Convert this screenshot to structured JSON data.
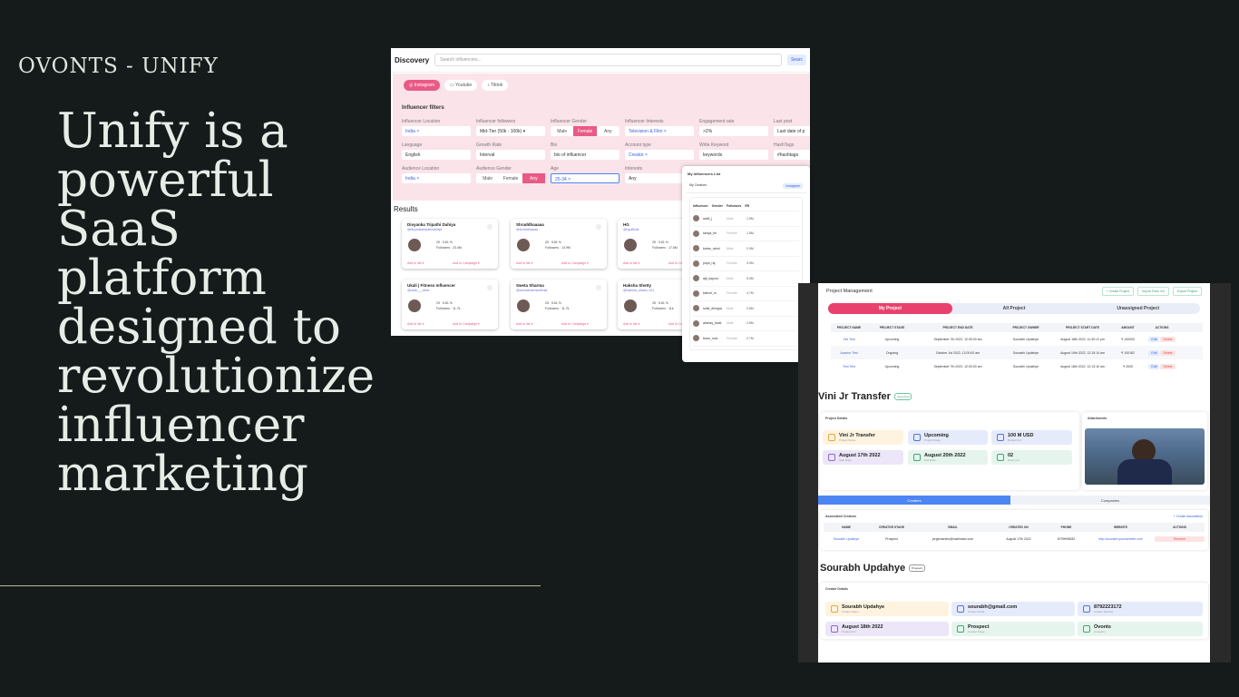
{
  "brand": "OVONTS - UNIFY",
  "headline": [
    "Unify is a",
    "powerful",
    "SaaS",
    "platform",
    "designed to",
    "revolutionize",
    "influencer",
    "marketing"
  ],
  "discovery": {
    "title": "Discovery",
    "search_placeholder": "Search influencers...",
    "search_button": "Searc",
    "tabs": [
      "Instagram",
      "Youtube",
      "Tiktok"
    ],
    "filters_title": "Influencer filters",
    "filters": [
      {
        "label": "Influencer Location",
        "value": "India ×"
      },
      {
        "label": "Influencer followers",
        "value": "Mid-Tier (50k - 100k) ▾"
      },
      {
        "label": "Influencer Gender",
        "segments": [
          "Male",
          "Female",
          "Any"
        ],
        "selected": "Female"
      },
      {
        "label": "Influencer Interests",
        "value": "Television & Film ×"
      },
      {
        "label": "Engagement rate",
        "value": ">2%"
      },
      {
        "label": "Last post",
        "value": "Last date of p"
      },
      {
        "label": "Language",
        "value": "English"
      },
      {
        "label": "Growth Rate",
        "value": "Interval"
      },
      {
        "label": "Bio",
        "value": "bio of influencer"
      },
      {
        "label": "Account type",
        "value": "Creator ×"
      },
      {
        "label": "Write Keyword",
        "value": "keywords"
      },
      {
        "label": "HashTags",
        "value": "#hashtags"
      },
      {
        "label": "Audience Location",
        "value": "India ×"
      },
      {
        "label": "Audience Gender",
        "segments": [
          "Male",
          "Female",
          "Any"
        ],
        "selected": "Any"
      },
      {
        "label": "Age",
        "value": "25-34 ×"
      },
      {
        "label": "Interests",
        "value": "Any"
      }
    ],
    "results_title": "Results",
    "cards": [
      {
        "name": "Divyanka Tripathi Dahiya",
        "handle": "@divyankatripathidahiya",
        "stats": [
          "29 · 5.81 %",
          "Followers · 23.4M"
        ],
        "b1": "Add to list ▾",
        "b2": "Add to Campaign ▾"
      },
      {
        "name": "Shraddhaaaaa",
        "handle": "@shraddhaaaa",
        "stats": [
          "25 · 5.81 %",
          "Followers · 13.9M"
        ],
        "b1": "Add to list ▾",
        "b2": "Add to Campaign ▾"
      },
      {
        "name": "HG",
        "handle": "@hgofficial",
        "stats": [
          "25 · 5.81 %",
          "Followers · 17.6M"
        ],
        "b1": "Add to list ▾",
        "b2": "Add to Campaign ▾"
      },
      {
        "name": "Ukali | Fitness Influencer",
        "handle": "@ukali___bebe",
        "stats": [
          "29 · 5.81 %",
          "Followers · 11.7k"
        ],
        "b1": "Add to list ▾",
        "b2": "Add to Campaign ▾"
      },
      {
        "name": "Sweta Sharma",
        "handle": "@swetasharmaofficial",
        "stats": [
          "25 · 5.81 %",
          "Followers · 11.7k"
        ],
        "b1": "Add to list ▾",
        "b2": "Add to Campaign ▾"
      },
      {
        "name": "Haksha Shetty",
        "handle": "@haksha_ahaan_001",
        "stats": [
          "25 · 5.81 %",
          "Followers · 11k"
        ],
        "b1": "Add to list ▾",
        "b2": "Add to Campaign ▾"
      }
    ]
  },
  "influencer_list": {
    "title": "My Influencers List",
    "subtitle": "My Creators",
    "tag": "Instagram",
    "headers": [
      "Influencer",
      "Gender",
      "Followers",
      "ER"
    ],
    "rows": [
      {
        "n": "ankit_j",
        "g": "Male",
        "c": "1.9M"
      },
      {
        "n": "taniya_bh",
        "g": "Female",
        "c": "1.8M"
      },
      {
        "n": "kahar_rahul",
        "g": "Male",
        "c": "2.0M"
      },
      {
        "n": "priya_raj",
        "g": "Female",
        "c": "3.0M"
      },
      {
        "n": "ajit_kapoor",
        "g": "Male",
        "c": "5.0M"
      },
      {
        "n": "kishori_m",
        "g": "Female",
        "c": "4.7M"
      },
      {
        "n": "sahil_dhingra",
        "g": "Male",
        "c": "2.6M"
      },
      {
        "n": "akshay_kwat",
        "g": "Male",
        "c": "2.8M"
      },
      {
        "n": "team_rock",
        "g": "Female",
        "c": "2.7M"
      }
    ]
  },
  "project": {
    "title": "Project Management",
    "actions": [
      "+ Create Project",
      "Import From Xcl",
      "Export Project"
    ],
    "tabs": [
      "My Project",
      "All Project",
      "Unassigned Project"
    ],
    "table_headers": [
      "PROJECT NAME",
      "PROJECT STAGE",
      "PROJECT END DATE",
      "PROJECT OWNER",
      "PROJECT START DATE",
      "AMOUNT",
      "ACTIONS"
    ],
    "rows": [
      {
        "name": "Vini Test",
        "stage": "Upcoming",
        "end": "September 7th 2022, 12:00:00 am",
        "owner": "Sourabh Updahye",
        "start": "August 18th 2022, 11:30:12 pm",
        "amount": "₹ 100000"
      },
      {
        "name": "Avantor Test",
        "stage": "Ongoing",
        "end": "October 1st 2022, 12:00:00 am",
        "owner": "Sourabh Updahye",
        "start": "August 19th 2022, 12:15:14 am",
        "amount": "₹ 100182"
      },
      {
        "name": "Test Test",
        "stage": "Upcoming",
        "end": "September 7th 2022, 12:00:00 am",
        "owner": "Sourabh Updahye",
        "start": "August 18th 2022, 12:13:10 am",
        "amount": "₹ 2000"
      }
    ],
    "edit_label": "Edit",
    "delete_label": "Delete",
    "detail_title": "Vini Jr Transfer",
    "detail_badge": "Upcoming",
    "details_panel": "Project Details",
    "attachments_panel": "Attachments",
    "tiles": [
      {
        "v": "Vini Jr Transfer",
        "s": "Project Name"
      },
      {
        "v": "Upcoming",
        "s": "Project Stage"
      },
      {
        "v": "100 M USD",
        "s": "Budget Amt"
      },
      {
        "v": "August 17th 2022",
        "s": "Start Date"
      },
      {
        "v": "August 20th 2022",
        "s": "End Date"
      },
      {
        "v": "02",
        "s": "Days Left"
      }
    ],
    "bottom_tabs": [
      "Creators",
      "Companies"
    ],
    "assoc_title": "Associated Creators",
    "assoc_button": "+ Create Association",
    "assoc_headers": [
      "NAME",
      "CREATOR STAGE",
      "EMAIL",
      "CREATED ON",
      "PHONE",
      "WEBSITE",
      "ACTIONS"
    ],
    "assoc_row": [
      "Sourabh Updahye",
      "Prospect",
      "jorgemartins@mailinator.com",
      "August 17th 2022",
      "8799998282",
      "http://sourabh.yourwebsite.com",
      "Remove"
    ],
    "creator_title": "Sourabh Updahye",
    "creator_badge": "Prospect",
    "creator_panel": "Creator Details",
    "creator_tiles": [
      {
        "v": "Sourabh Updahye",
        "s": "Creator Name"
      },
      {
        "v": "sourabh@gmail.com",
        "s": "Creator Email"
      },
      {
        "v": "8792223172",
        "s": "Creator Number"
      },
      {
        "v": "August 18th 2022",
        "s": "Created On"
      },
      {
        "v": "Prospect",
        "s": "Creator Stage"
      },
      {
        "v": "Ovonts",
        "s": "Company"
      }
    ]
  }
}
